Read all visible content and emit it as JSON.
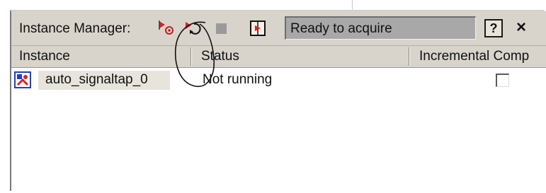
{
  "toolbar": {
    "label": "Instance Manager:",
    "status": "Ready to acquire",
    "icons": [
      "run-analysis-icon",
      "autorun-analysis-icon",
      "stop-analysis-icon",
      "read-data-icon"
    ],
    "help_icon": "help-icon",
    "help_glyph": "?",
    "close_icon": "close-icon",
    "close_glyph": "×"
  },
  "table": {
    "columns": [
      "Instance",
      "Status",
      "Incremental Comp"
    ],
    "rows": [
      {
        "icon": "signaltap-instance-icon",
        "instance": "auto_signaltap_0",
        "status": "Not running",
        "incremental_compilation": false
      }
    ]
  },
  "colors": {
    "panel_bg": "#d8d4cc",
    "status_box_bg": "#a8a8a8",
    "icon_red": "#e02020",
    "icon_blue": "#2040c0"
  }
}
